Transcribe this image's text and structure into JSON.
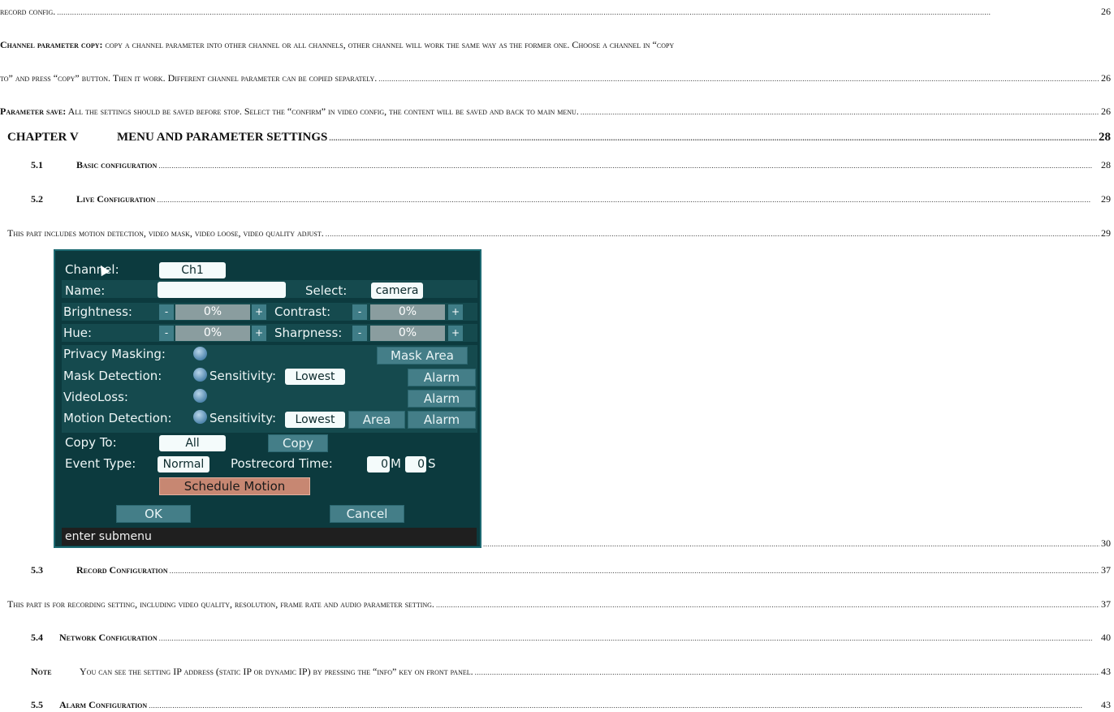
{
  "toc": {
    "record_config": {
      "text": "record config.",
      "page": "26"
    },
    "copy_heading": "Channel parameter copy:",
    "copy_text_1": " copy a channel parameter into other channel or all channels, other channel will work the same way as the former one. Choose a channel in “copy",
    "copy_page_1": "",
    "copy_text_2": "to” and press “copy” button. Then it work. Different channel parameter can be copied separately.",
    "copy_page_2": "26",
    "save_heading": "Parameter save:",
    "save_text": " All the settings should be saved before stop. Select the “confirm” in video config, the content will be saved and back to main menu.",
    "save_page": "26",
    "chapter": {
      "num": "CHAPTER V",
      "title": "MENU AND PARAMETER SETTINGS",
      "page": "28"
    },
    "s51": {
      "num": "5.1",
      "title": "Basic configuration",
      "page": "28"
    },
    "s52": {
      "num": "5.2",
      "title": "Live Configuration",
      "page": "29"
    },
    "s52_desc": {
      "text": "This part includes motion detection, video mask, video loose, video quality adjust.",
      "page": "29"
    },
    "img_page": "30",
    "s53": {
      "num": "5.3",
      "title": "Record Configuration",
      "page": "37"
    },
    "s53_desc": {
      "text": "This part is for recording setting, including video quality, resolution, frame rate and audio parameter setting.",
      "page": "37"
    },
    "s54": {
      "num": "5.4",
      "title": "Network Configuration",
      "page": "40"
    },
    "note": {
      "label": "Note",
      "text": "You can see the setting IP address (static IP or dynamic IP) by pressing the “info” key on front panel.",
      "page": "43"
    },
    "s55": {
      "num": "5.5",
      "title": "Alarm Configuration",
      "page": "43"
    }
  },
  "dvr": {
    "channel_label": "Channel:",
    "channel_value": "Ch1",
    "name_label": "Name:",
    "name_value": "",
    "select_label": "Select:",
    "select_value": "camera",
    "brightness_label": "Brightness:",
    "brightness_value": "0%",
    "contrast_label": "Contrast:",
    "contrast_value": "0%",
    "hue_label": "Hue:",
    "hue_value": "0%",
    "sharpness_label": "Sharpness:",
    "sharpness_value": "0%",
    "minus": "-",
    "plus": "+",
    "privacy_label": "Privacy Masking:",
    "mask_area": "Mask Area",
    "mask_detect_label": "Mask Detection:",
    "sensitivity_label": "Sensitivity:",
    "sensitivity_value": "Lowest",
    "alarm": "Alarm",
    "videoloss_label": "VideoLoss:",
    "motion_label": "Motion Detection:",
    "area": "Area",
    "copy_to_label": "Copy To:",
    "copy_to_value": "All",
    "copy_btn": "Copy",
    "event_type_label": "Event Type:",
    "event_type_value": "Normal",
    "postrecord_label": "Postrecord Time:",
    "post_min": "0",
    "post_m": "M",
    "post_sec": "0",
    "post_s": "S",
    "schedule": "Schedule Motion",
    "ok": "OK",
    "cancel": "Cancel",
    "status": "enter submenu"
  }
}
